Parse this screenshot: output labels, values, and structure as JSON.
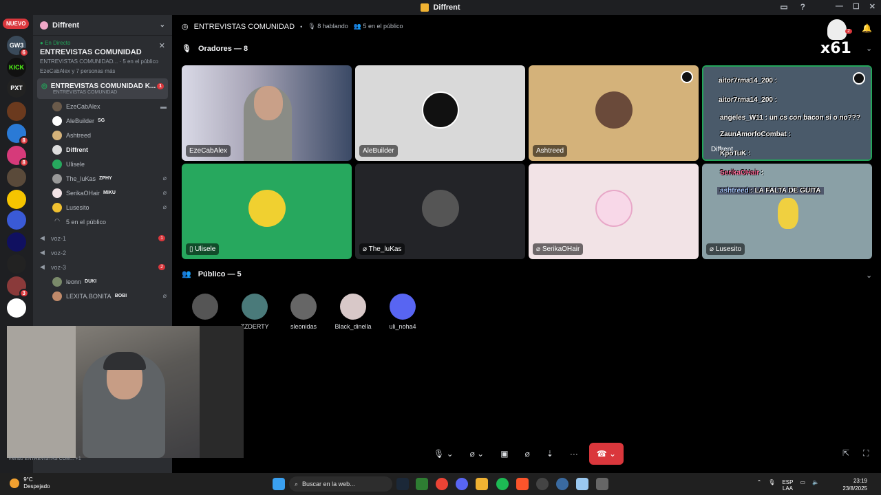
{
  "window": {
    "title": "Diffrent"
  },
  "servers": {
    "new_badge": "NUEVO",
    "items": [
      "GW3",
      "KICK",
      "PXT"
    ],
    "badges": [
      "6",
      "8",
      "8",
      "3"
    ]
  },
  "sidebar": {
    "guild_name": "Diffrent",
    "live": {
      "tag": "En Directo",
      "title": "ENTREVISTAS COMUNIDAD",
      "subtitle": "ENTREVISTAS COMUNIDAD...",
      "audience": "5 en el público",
      "viewers": "EzeCabAlex y 7 personas más"
    },
    "active_channel": {
      "name": "ENTREVISTAS COMUNIDAD K...",
      "sub": "ENTREVISTAS COMUNIDAD",
      "badge": "1"
    },
    "members": [
      {
        "name": "EzeCabAlex",
        "tag": ""
      },
      {
        "name": "AleBuilder",
        "tag": "SG"
      },
      {
        "name": "Ashtreed",
        "tag": ""
      },
      {
        "name": "Diffrent",
        "tag": ""
      },
      {
        "name": "Ulisele",
        "tag": ""
      },
      {
        "name": "The_luKas",
        "tag": "ZPHY"
      },
      {
        "name": "SerikaOHair",
        "tag": "MIKU"
      },
      {
        "name": "Lusesito",
        "tag": ""
      }
    ],
    "public_count": "5 en el público",
    "voice_channels": [
      {
        "name": "voz-1",
        "badge": "1"
      },
      {
        "name": "voz-2",
        "badge": ""
      },
      {
        "name": "voz-3",
        "badge": "2"
      }
    ],
    "voz3_members": [
      {
        "name": "leonn",
        "tag": "DUKI"
      },
      {
        "name": "LEXITA.BONITA",
        "tag": "BOBI"
      }
    ],
    "viewing_text": "Viendo ENTREVISTAS COM...",
    "viewing_extra": "+1"
  },
  "stage": {
    "title": "ENTREVISTAS COMUNIDAD",
    "speaking": "8 hablando",
    "audience": "5 en el público",
    "speakers_header": "Oradores — 8",
    "overlay_count": "x61",
    "overlay_badge": "2",
    "tiles": [
      {
        "label": "EzeCabAlex",
        "bg": "#3b4a66"
      },
      {
        "label": "AleBuilder",
        "bg": "#d9d9d9"
      },
      {
        "label": "Ashtreed",
        "bg": "#d4b27a"
      },
      {
        "label": "Diffrent",
        "bg": "#4a5a6a"
      },
      {
        "label": "Ulisele",
        "bg": "#27a85e"
      },
      {
        "label": "The_luKas",
        "bg": "#232428"
      },
      {
        "label": "SerikaOHair",
        "bg": "#f2e3e6"
      },
      {
        "label": "Lusesito",
        "bg": "#8aa0a6"
      }
    ],
    "chat": [
      {
        "user": "aitor7rma14_200",
        "text": ":"
      },
      {
        "user": "aitor7rma14_200",
        "text": ":"
      },
      {
        "user": "angeles_W11",
        "text": ": un cs con bacon si o no???"
      },
      {
        "user": "ZaunAmorfoCombat",
        "text": ":"
      },
      {
        "user": "KpoTuK",
        "text": ":"
      },
      {
        "user": "SerikaOHair",
        "text": ":"
      },
      {
        "user": "ashtreed",
        "text": ": LA FALTA DE GUITA"
      }
    ],
    "audience_header": "Público — 5",
    "audience_members": [
      "",
      "ZZDERTY",
      "sleonidas",
      "Black_dinella",
      "uli_noha4"
    ]
  },
  "taskbar": {
    "temperature": "9°C",
    "weather": "Despejado",
    "search_placeholder": "Buscar en la web...",
    "lang": "ESP",
    "lang2": "LAA",
    "time": "23:19",
    "date": "23/8/2025"
  },
  "colors": {
    "accent": "#5865f2",
    "danger": "#da373c",
    "online": "#23a55a"
  }
}
